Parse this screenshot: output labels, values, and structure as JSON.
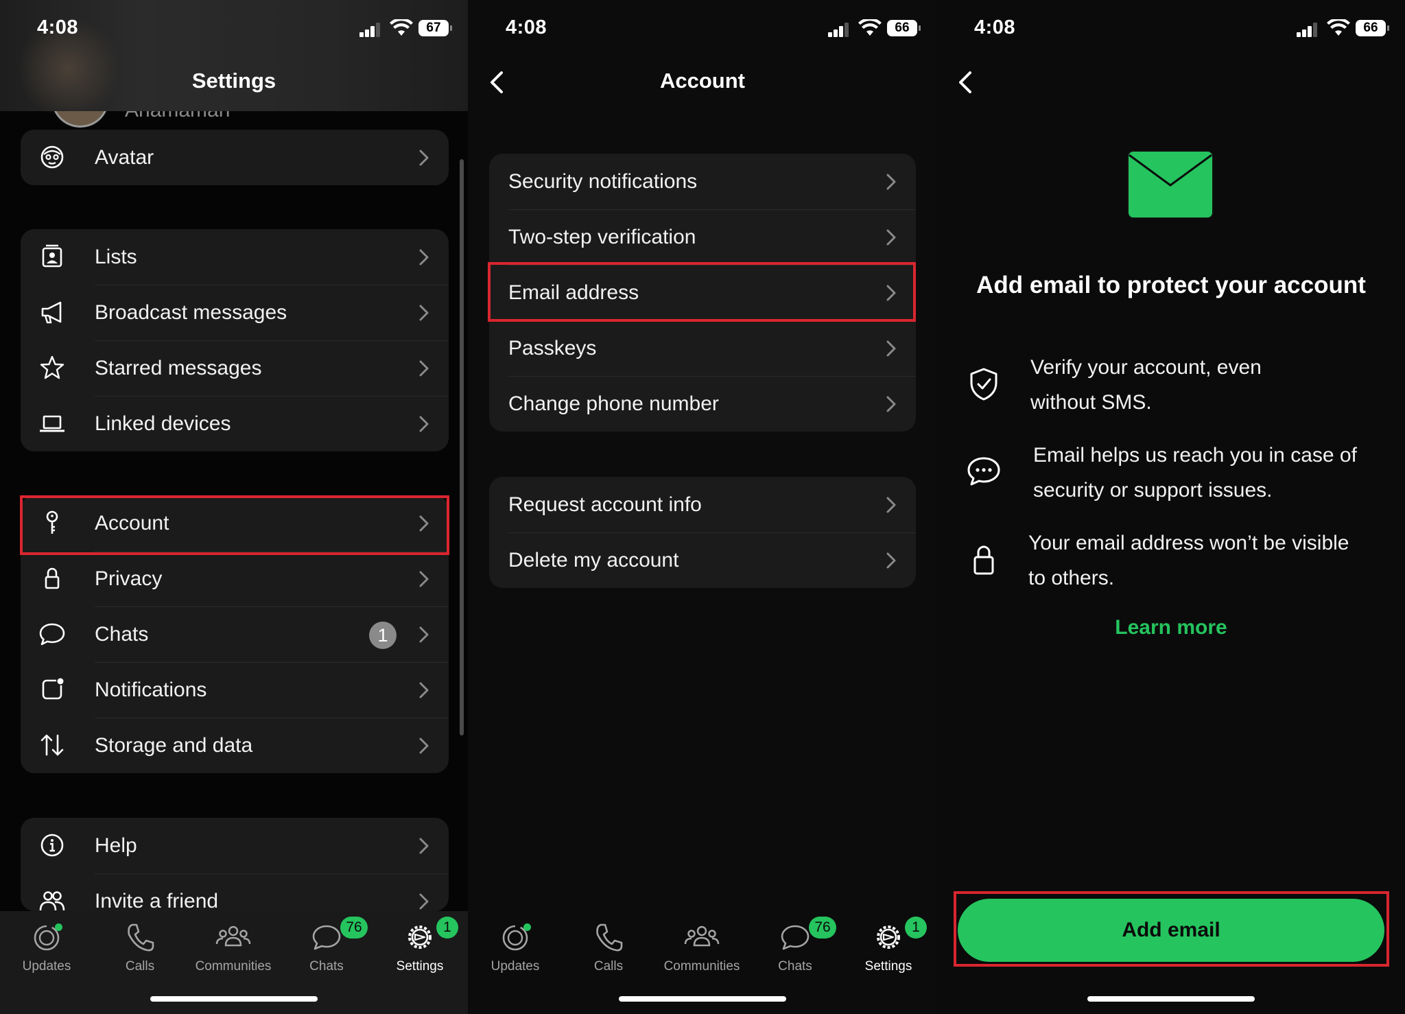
{
  "status": {
    "time": "4:08",
    "battery_p1": "67",
    "battery_p2": "66",
    "battery_p3": "66"
  },
  "settings": {
    "title": "Settings",
    "profile_name_partial": "Anamaman",
    "group1": [
      {
        "label": "Avatar",
        "icon": "avatar-icon"
      }
    ],
    "group2": [
      {
        "label": "Lists",
        "icon": "lists-icon"
      },
      {
        "label": "Broadcast messages",
        "icon": "megaphone-icon"
      },
      {
        "label": "Starred messages",
        "icon": "star-icon"
      },
      {
        "label": "Linked devices",
        "icon": "laptop-icon"
      }
    ],
    "group3": [
      {
        "label": "Account",
        "icon": "key-icon"
      },
      {
        "label": "Privacy",
        "icon": "lock-icon"
      },
      {
        "label": "Chats",
        "icon": "chat-bubble-icon",
        "badge": "1"
      },
      {
        "label": "Notifications",
        "icon": "notification-icon"
      },
      {
        "label": "Storage and data",
        "icon": "arrows-updown-icon"
      }
    ],
    "group4": [
      {
        "label": "Help",
        "icon": "info-icon"
      },
      {
        "label": "Invite a friend",
        "icon": "people-icon"
      }
    ]
  },
  "account": {
    "title": "Account",
    "group1": [
      {
        "label": "Security notifications"
      },
      {
        "label": "Two-step verification"
      },
      {
        "label": "Email address"
      },
      {
        "label": "Passkeys"
      },
      {
        "label": "Change phone number"
      }
    ],
    "group2": [
      {
        "label": "Request account info"
      },
      {
        "label": "Delete my account"
      }
    ]
  },
  "email": {
    "heading": "Add email to protect your account",
    "features": [
      {
        "icon": "shield-check-icon",
        "line1": "Verify your account, even",
        "line2": "without SMS."
      },
      {
        "icon": "speech-bubble-dots-icon",
        "line1": "Email helps us reach you in case of",
        "line2": "security or support issues."
      },
      {
        "icon": "padlock-icon",
        "line1": "Your email address won’t be visible",
        "line2": "to others."
      }
    ],
    "learn_more": "Learn more",
    "add_button": "Add email"
  },
  "tabbar": {
    "tabs": [
      {
        "label": "Updates",
        "icon": "updates-icon"
      },
      {
        "label": "Calls",
        "icon": "phone-icon"
      },
      {
        "label": "Communities",
        "icon": "communities-icon"
      },
      {
        "label": "Chats",
        "icon": "chats-icon",
        "badge": "76"
      },
      {
        "label": "Settings",
        "icon": "settings-gear-icon",
        "badge": "1"
      }
    ]
  },
  "colors": {
    "accent": "#25c45e",
    "highlight": "#d9262f",
    "row_bg": "#1b1b1b"
  }
}
